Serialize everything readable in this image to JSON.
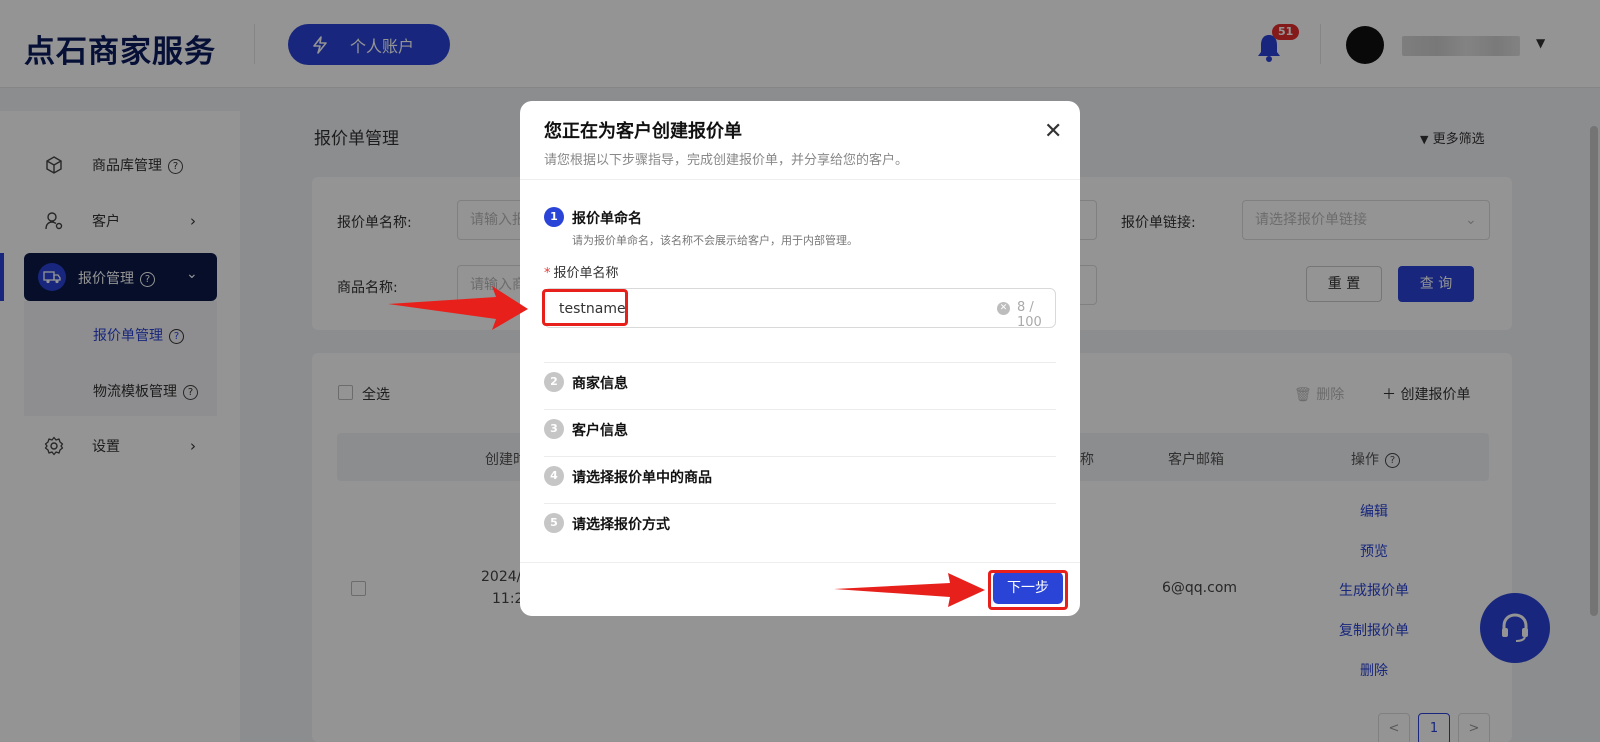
{
  "header": {
    "logo": "点石商家服务",
    "account_button": "个人账户",
    "notification_count": "51",
    "username": "user"
  },
  "sidebar": {
    "items": [
      {
        "label": "商品库管理"
      },
      {
        "label": "客户"
      },
      {
        "label": "报价管理"
      },
      {
        "label": "设置"
      }
    ],
    "submenu": [
      {
        "label": "报价单管理"
      },
      {
        "label": "物流模板管理"
      }
    ]
  },
  "main": {
    "title": "报价单管理",
    "more_filter": "更多筛选",
    "filters": {
      "quote_name_label": "报价单名称:",
      "quote_name_placeholder": "请输入报",
      "product_name_label": "商品名称:",
      "product_name_placeholder": "请输入商",
      "quote_link_label": "报价单链接:",
      "quote_link_placeholder": "请选择报价单链接",
      "reset_label": "重 置",
      "query_label": "查 询"
    },
    "list": {
      "select_all": "全选",
      "delete": "删除",
      "create": "创建报价单",
      "headers": {
        "created": "创建时",
        "name_tail": "称",
        "email": "客户邮箱",
        "ops": "操作"
      },
      "row": {
        "date": "2024/",
        "time": "11:2",
        "email": "6@qq.com",
        "ops": [
          "编辑",
          "预览",
          "生成报价单",
          "复制报价单",
          "删除"
        ]
      },
      "pager": {
        "prev": "<",
        "current": "1",
        "next": ">"
      }
    }
  },
  "modal": {
    "title": "您正在为客户创建报价单",
    "subtitle": "请您根据以下步骤指导，完成创建报价单，并分享给您的客户。",
    "steps": [
      {
        "num": "1",
        "label": "报价单命名",
        "hint": "请为报价单命名，该名称不会展示给客户，用于内部管理。"
      },
      {
        "num": "2",
        "label": "商家信息"
      },
      {
        "num": "3",
        "label": "客户信息"
      },
      {
        "num": "4",
        "label": "请选择报价单中的商品"
      },
      {
        "num": "5",
        "label": "请选择报价方式"
      }
    ],
    "field_label": "报价单名称",
    "required_mark": "*",
    "name_value": "testname",
    "counter": "8 / 100",
    "next_button": "下一步"
  },
  "colors": {
    "accent": "#2a44d8",
    "dark_nav": "#0c1948",
    "annotation_red": "#e8201b",
    "badge_red": "#e62e2e"
  }
}
